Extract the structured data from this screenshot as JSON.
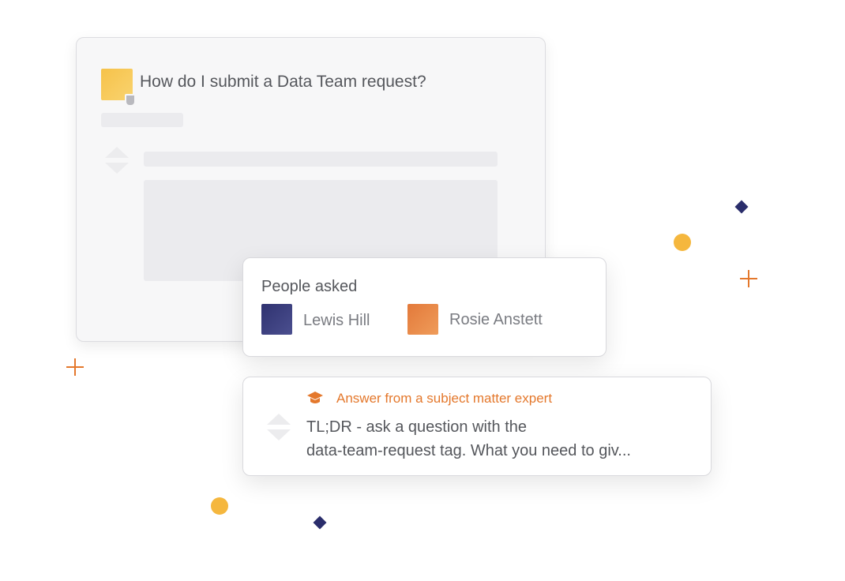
{
  "question_card": {
    "title": "How do I submit a Data Team request?",
    "avatar_color": "#f6c24a"
  },
  "people_card": {
    "label": "People asked",
    "people": [
      {
        "name": "Lewis Hill",
        "avatar_color": "#3b3e7c"
      },
      {
        "name": "Rosie Anstett",
        "avatar_color": "#e8894a"
      }
    ]
  },
  "answer_card": {
    "label": "Answer from a subject matter expert",
    "icon": "graduation-cap-icon",
    "text_lines": [
      "TL;DR - ask a question with the",
      "data-team-request tag. What you need to giv..."
    ]
  },
  "colors": {
    "accent_orange": "#e4782c",
    "accent_yellow": "#f5b73e",
    "accent_navy": "#2a2d6b"
  }
}
